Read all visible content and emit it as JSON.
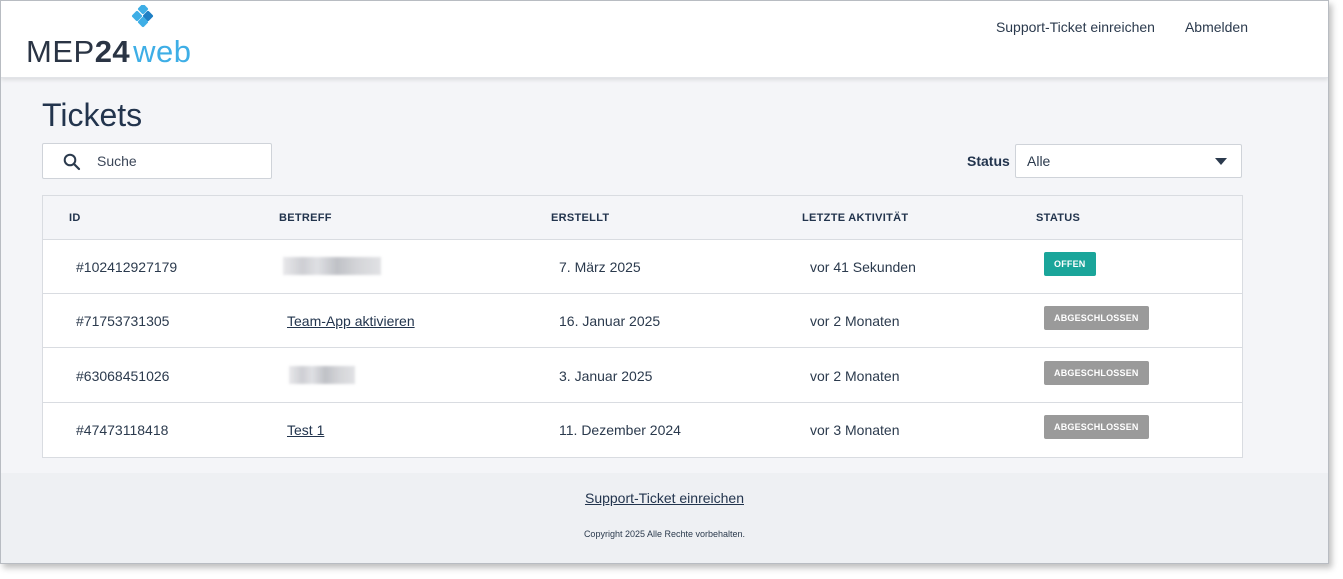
{
  "brand": {
    "logo_parts": [
      "MEP",
      "24",
      "web"
    ],
    "colors": {
      "dark": "#2a3444",
      "accent": "#3eaee6"
    }
  },
  "header": {
    "nav": [
      {
        "label": "Support-Ticket einreichen"
      },
      {
        "label": "Abmelden"
      }
    ]
  },
  "page": {
    "title": "Tickets"
  },
  "search": {
    "placeholder": "Suche",
    "icon": "search-icon"
  },
  "filter": {
    "label": "Status",
    "selected": "Alle",
    "icon": "caret-down-icon"
  },
  "table": {
    "columns": [
      "ID",
      "BETREFF",
      "ERSTELLT",
      "LETZTE AKTIVITÄT",
      "STATUS"
    ],
    "rows": [
      {
        "id": "#102412927179",
        "subject": "",
        "subject_redacted": true,
        "created": "7. März 2025",
        "last_activity": "vor 41 Sekunden",
        "status": "OFFEN",
        "status_color": "#1aa59a"
      },
      {
        "id": "#71753731305",
        "subject": "Team-App aktivieren",
        "subject_redacted": false,
        "created": "16. Januar 2025",
        "last_activity": "vor 2 Monaten",
        "status": "ABGESCHLOSSEN",
        "status_color": "#9a9a9a"
      },
      {
        "id": "#63068451026",
        "subject": "",
        "subject_redacted": true,
        "created": "3. Januar 2025",
        "last_activity": "vor 2 Monaten",
        "status": "ABGESCHLOSSEN",
        "status_color": "#9a9a9a"
      },
      {
        "id": "#47473118418",
        "subject": "Test 1",
        "subject_redacted": false,
        "created": "11. Dezember 2024",
        "last_activity": "vor 3 Monaten",
        "status": "ABGESCHLOSSEN",
        "status_color": "#9a9a9a"
      }
    ]
  },
  "footer": {
    "link": "Support-Ticket einreichen",
    "copyright": "Copyright 2025 Alle Rechte vorbehalten."
  }
}
